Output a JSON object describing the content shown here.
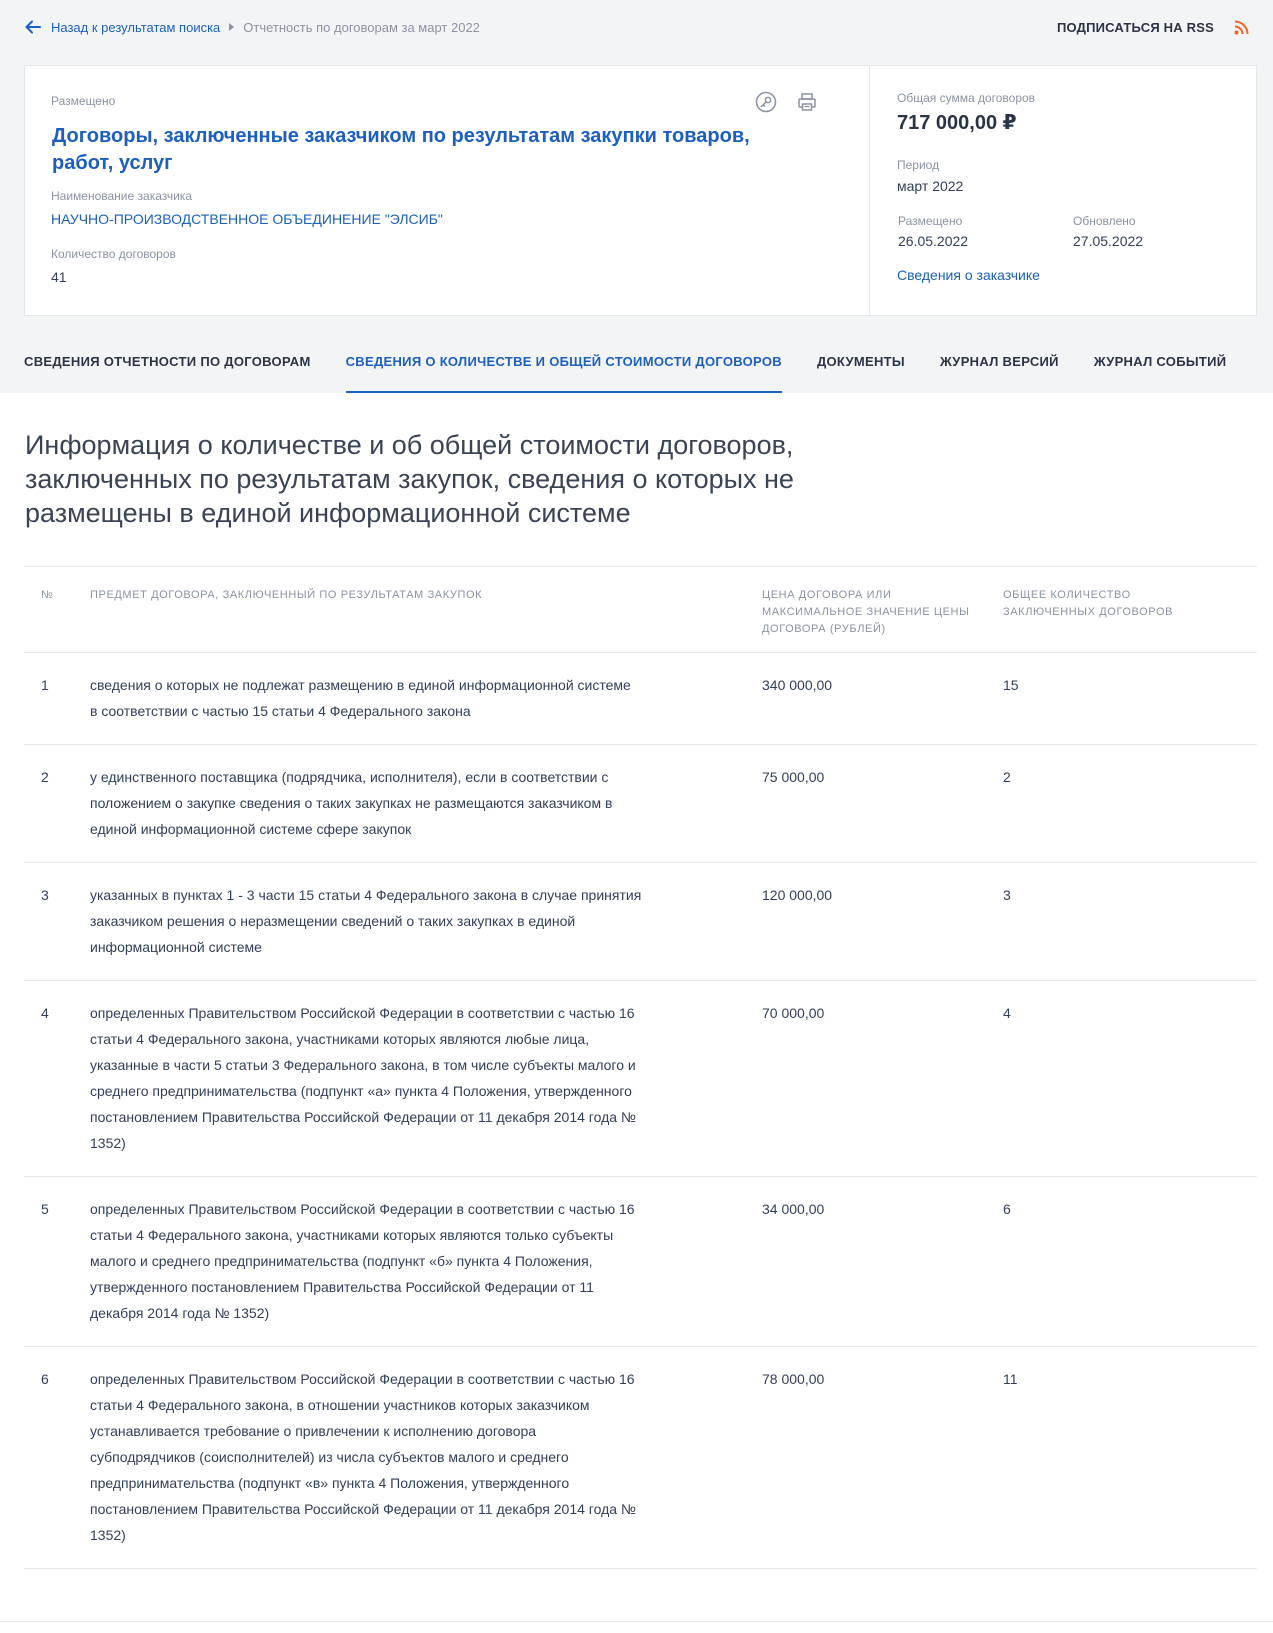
{
  "breadcrumb": {
    "back_label": "Назад к результатам поиска",
    "current": "Отчетность по договорам за март 2022"
  },
  "rss": {
    "label": "ПОДПИСАТЬСЯ НА RSS"
  },
  "card": {
    "status": "Размещено",
    "title": "Договоры, заключенные заказчиком по результатам закупки товаров, работ, услуг",
    "customer_label": "Наименование заказчика",
    "customer_name": "НАУЧНО-ПРОИЗВОДСТВЕННОЕ ОБЪЕДИНЕНИЕ \"ЭЛСИБ\"",
    "count_label": "Количество договоров",
    "count_value": "41",
    "total_label": "Общая сумма договоров",
    "total_value": "717 000,00 ₽",
    "period_label": "Период",
    "period_value": "март 2022",
    "published_label": "Размещено",
    "published_value": "26.05.2022",
    "updated_label": "Обновлено",
    "updated_value": "27.05.2022",
    "customer_info_link": "Сведения о заказчике"
  },
  "tabs": [
    {
      "label": "СВЕДЕНИЯ ОТЧЕТНОСТИ ПО ДОГОВОРАМ",
      "active": false
    },
    {
      "label": "СВЕДЕНИЯ О КОЛИЧЕСТВЕ И ОБЩЕЙ СТОИМОСТИ ДОГОВОРОВ",
      "active": true
    },
    {
      "label": "ДОКУМЕНТЫ",
      "active": false
    },
    {
      "label": "ЖУРНАЛ ВЕРСИЙ",
      "active": false
    },
    {
      "label": "ЖУРНАЛ СОБЫТИЙ",
      "active": false
    }
  ],
  "section_title": "Информация о количестве и об общей стоимости договоров, заключенных по результатам закупок, сведения о которых не размещены в единой информационной системе",
  "table": {
    "headers": {
      "num": "№",
      "subject": "Предмет договора, заключенный по результатам закупок",
      "price": "Цена договора или максимальное значение цены договора (рублей)",
      "count": "Общее количество заключенных договоров"
    },
    "rows": [
      {
        "num": "1",
        "subject": "сведения о которых не подлежат размещению в единой информационной системе в соответствии с частью 15 статьи 4 Федерального закона",
        "price": "340 000,00",
        "count": "15"
      },
      {
        "num": "2",
        "subject": "у единственного поставщика (подрядчика, исполнителя), если в соответствии с положением о закупке сведения о таких закупках не размещаются заказчиком в единой информационной системе сфере закупок",
        "price": "75 000,00",
        "count": "2"
      },
      {
        "num": "3",
        "subject": "указанных в пунктах 1 - 3 части 15 статьи 4 Федерального закона в случае принятия заказчиком решения о неразмещении сведений о таких закупках в единой информационной системе",
        "price": "120 000,00",
        "count": "3"
      },
      {
        "num": "4",
        "subject": "определенных Правительством Российской Федерации в соответствии с частью 16 статьи 4 Федерального закона, участниками которых являются любые лица, указанные в части 5 статьи 3 Федерального закона, в том числе субъекты малого и среднего предпринимательства (подпункт «а» пункта 4 Положения, утвержденного постановлением Правительства Российской Федерации от 11 декабря 2014 года № 1352)",
        "price": "70 000,00",
        "count": "4"
      },
      {
        "num": "5",
        "subject": "определенных Правительством Российской Федерации в соответствии с частью 16 статьи 4 Федерального закона, участниками которых являются только субъекты малого и среднего предпринимательства (подпункт «б» пункта 4 Положения, утвержденного постановлением Правительства Российской Федерации от 11 декабря 2014 года № 1352)",
        "price": "34 000,00",
        "count": "6"
      },
      {
        "num": "6",
        "subject": "определенных Правительством Российской Федерации в соответствии с частью 16 статьи 4 Федерального закона, в отношении участников которых заказчиком устанавливается требование о привлечении к исполнению договора субподрядчиков (соисполнителей) из числа субъектов малого и среднего предпринимательства (подпункт «в» пункта 4 Положения, утвержденного постановлением Правительства Российской Федерации от 11 декабря 2014 года № 1352)",
        "price": "78 000,00",
        "count": "11"
      }
    ]
  }
}
